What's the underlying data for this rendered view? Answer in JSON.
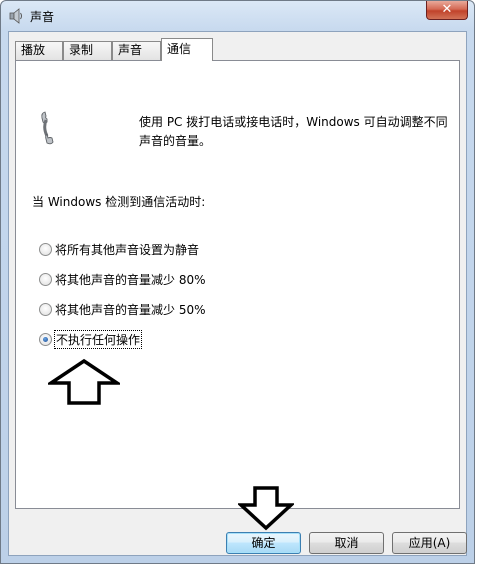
{
  "window": {
    "title": "声音",
    "close_label": "✕"
  },
  "tabs": [
    {
      "label": "播放",
      "active": false
    },
    {
      "label": "录制",
      "active": false
    },
    {
      "label": "声音",
      "active": false
    },
    {
      "label": "通信",
      "active": true
    }
  ],
  "communications": {
    "description": "使用 PC 拨打电话或接电话时，Windows 可自动调整不同声音的音量。",
    "prompt": "当 Windows 检测到通信活动时:",
    "options": [
      {
        "label": "将所有其他声音设置为静音",
        "selected": false
      },
      {
        "label": "将其他声音的音量减少 80%",
        "selected": false
      },
      {
        "label": "将其他声音的音量减少 50%",
        "selected": false
      },
      {
        "label": "不执行任何操作",
        "selected": true
      }
    ]
  },
  "buttons": {
    "ok": "确定",
    "cancel": "取消",
    "apply": "应用(A)"
  },
  "colors": {
    "title_gradient": "#c7d9ee",
    "close_red": "#c1432b",
    "radio_selected": "#1a4c92"
  }
}
